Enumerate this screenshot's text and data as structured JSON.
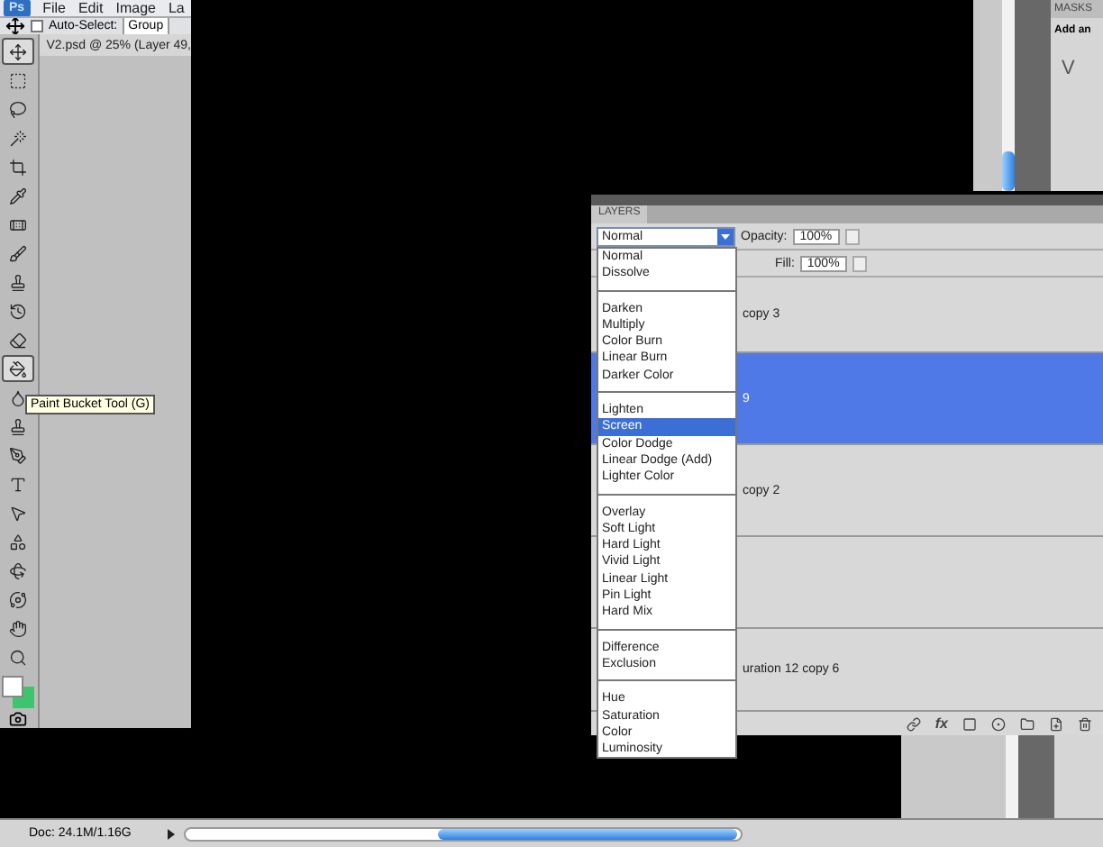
{
  "menu_bar": {
    "logo": "Ps",
    "items": [
      "File",
      "Edit",
      "Image",
      "La"
    ]
  },
  "options_bar": {
    "auto_select": {
      "label": "Auto-Select:",
      "checked": false
    },
    "target": "Group"
  },
  "document": {
    "tab_title": "V2.psd @ 25% (Layer 49,"
  },
  "toolbox": {
    "tools": [
      {
        "selected": true
      },
      {
        "selected": false
      },
      {
        "selected": false
      },
      {
        "selected": false
      },
      {
        "selected": false
      },
      {
        "selected": false
      },
      {
        "selected": false
      },
      {
        "selected": false
      },
      {
        "selected": false
      },
      {
        "selected": false
      },
      {
        "selected": false
      },
      {
        "selected": true
      },
      {
        "selected": false
      },
      {
        "selected": false
      },
      {
        "selected": false
      },
      {
        "selected": false
      },
      {
        "selected": false
      },
      {
        "selected": false
      },
      {
        "selected": false
      },
      {
        "selected": false
      },
      {
        "selected": false
      },
      {
        "selected": false
      }
    ],
    "tooltip": "Paint Bucket Tool (G)"
  },
  "status_bar": {
    "doc_size": "Doc: 24.1M/1.16G"
  },
  "masks_panel": {
    "tab": "MASKS",
    "text": "Add an",
    "glyph": "V"
  },
  "layers_panel": {
    "tab": "LAYERS",
    "blend_mode": "Normal",
    "opacity_label": "Opacity:",
    "opacity": "100%",
    "fill_label": "Fill:",
    "fill": "100%",
    "blend_menu": [
      [
        {
          "label": "Normal",
          "selected": false
        },
        {
          "label": "Dissolve",
          "selected": false
        }
      ],
      [
        {
          "label": "Darken",
          "selected": false
        },
        {
          "label": "Multiply",
          "selected": false
        },
        {
          "label": "Color Burn",
          "selected": false
        },
        {
          "label": "Linear Burn",
          "selected": false
        },
        {
          "label": "Darker Color",
          "selected": false
        }
      ],
      [
        {
          "label": "Lighten",
          "selected": false
        },
        {
          "label": "Screen",
          "selected": true
        },
        {
          "label": "Color Dodge",
          "selected": false
        },
        {
          "label": "Linear Dodge (Add)",
          "selected": false
        },
        {
          "label": "Lighter Color",
          "selected": false
        }
      ],
      [
        {
          "label": "Overlay",
          "selected": false
        },
        {
          "label": "Soft Light",
          "selected": false
        },
        {
          "label": "Hard Light",
          "selected": false
        },
        {
          "label": "Vivid Light",
          "selected": false
        },
        {
          "label": "Linear Light",
          "selected": false
        },
        {
          "label": "Pin Light",
          "selected": false
        },
        {
          "label": "Hard Mix",
          "selected": false
        }
      ],
      [
        {
          "label": "Difference",
          "selected": false
        },
        {
          "label": "Exclusion",
          "selected": false
        }
      ],
      [
        {
          "label": "Hue",
          "selected": false
        },
        {
          "label": "Saturation",
          "selected": false
        },
        {
          "label": "Color",
          "selected": false
        },
        {
          "label": "Luminosity",
          "selected": false
        }
      ]
    ],
    "layers": [
      {
        "name": "copy 3",
        "selected": false
      },
      {
        "name": "9",
        "selected": true
      },
      {
        "name": "copy 2",
        "selected": false
      },
      {
        "selected": false
      },
      {
        "name": "uration 12 copy 6",
        "selected": false
      }
    ],
    "footer_fx": "fx"
  }
}
